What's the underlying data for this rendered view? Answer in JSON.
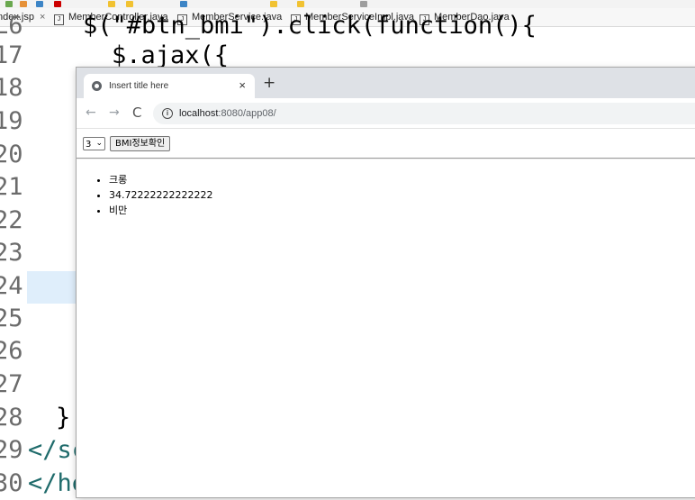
{
  "ide": {
    "tabs": [
      {
        "label": "ndex.jsp",
        "closable": true,
        "active": true
      },
      {
        "label": "MemberController.java"
      },
      {
        "label": "MemberService.java"
      },
      {
        "label": "MemberServiceImpl.java"
      },
      {
        "label": "MemberDao.java"
      }
    ],
    "line_numbers": [
      "L6",
      "17",
      "18",
      "19",
      "20",
      "21",
      "22",
      "23",
      "24",
      "25",
      "26",
      "27",
      "28",
      "29",
      "30"
    ],
    "code_lines": [
      "$(\"#btn_bmi\").click(function(){",
      "$.ajax({",
      "}",
      "</sc",
      "</he"
    ]
  },
  "browser": {
    "tab_title": "Insert title here",
    "new_tab_label": "+",
    "url_host": "localhost",
    "url_rest": ":8080/app08/",
    "back_icon": "←",
    "forward_icon": "→",
    "reload_icon": "C"
  },
  "page": {
    "select_value": "3",
    "button_label": "BMI정보확인",
    "results": [
      "크롱",
      "34.72222222222222",
      "비만"
    ]
  }
}
